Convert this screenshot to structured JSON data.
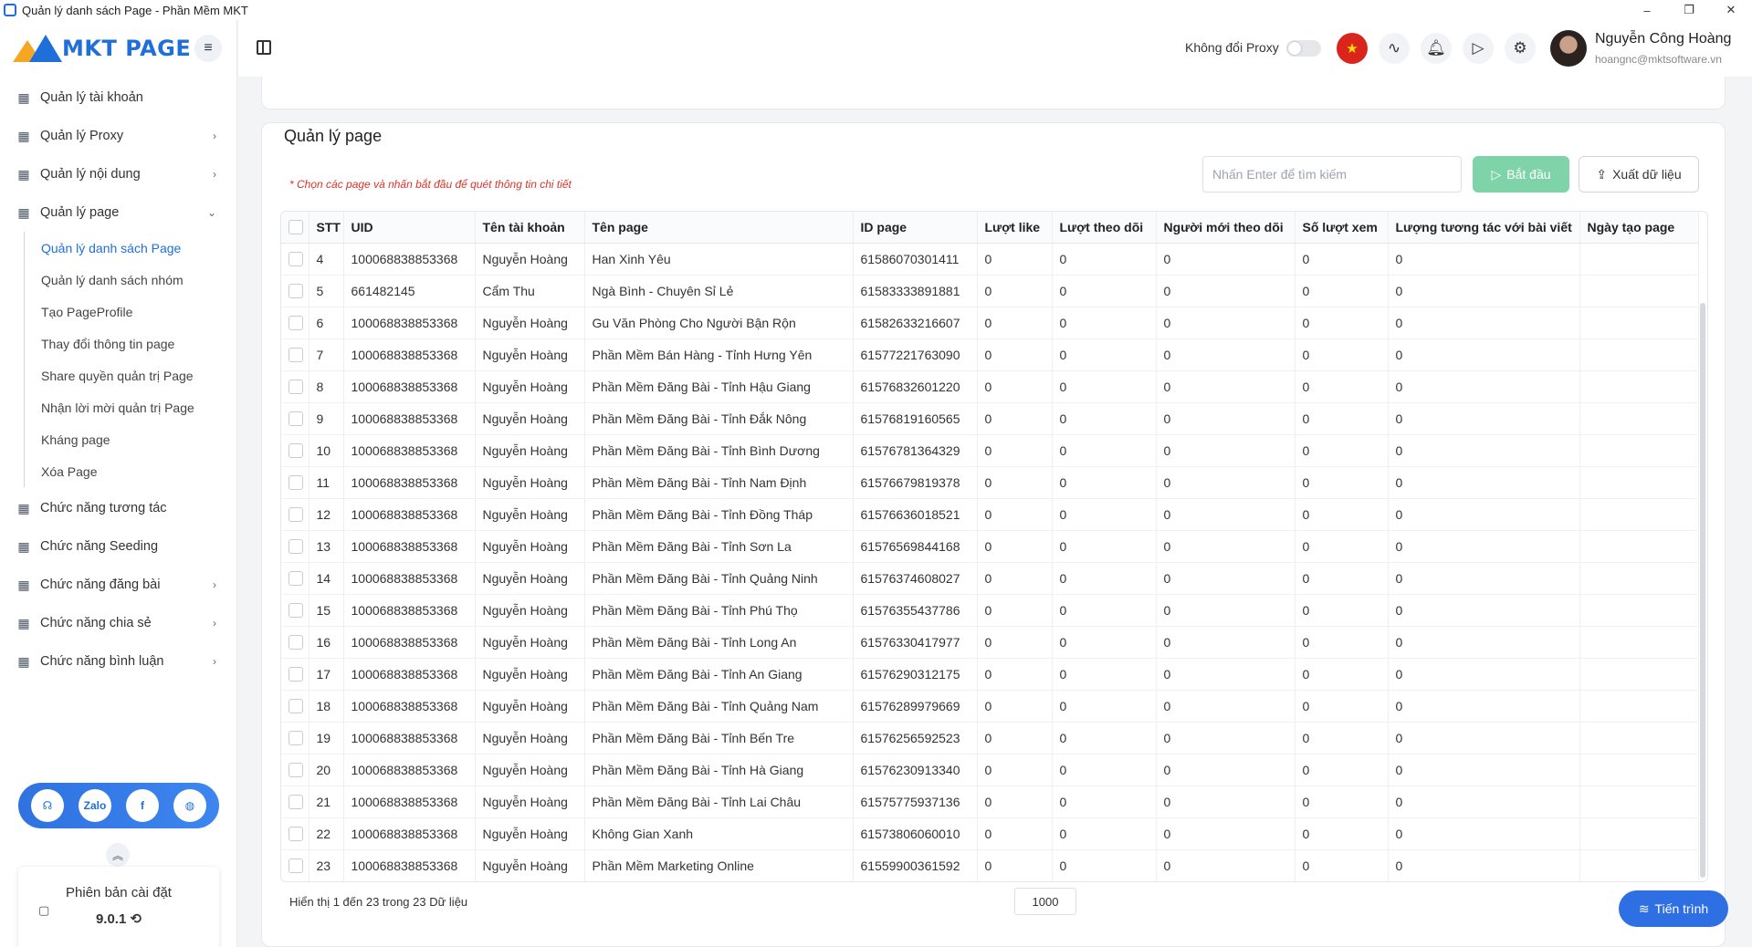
{
  "window": {
    "title": "Quản lý danh sách Page - Phần Mềm MKT",
    "minimize": "–",
    "restore": "❐",
    "close": "✕"
  },
  "logo": {
    "text": "MKT PAGE"
  },
  "sidebar": {
    "items": [
      {
        "label": "Quản lý tài khoản",
        "icon": "grid-icon"
      },
      {
        "label": "Quản lý Proxy",
        "icon": "layers-icon",
        "chevron": "›"
      },
      {
        "label": "Quản lý nội dung",
        "icon": "content-icon",
        "chevron": "›"
      },
      {
        "label": "Quản lý page",
        "icon": "page-icon",
        "chevron": "⌄"
      }
    ],
    "subitems": [
      {
        "label": "Quản lý danh sách Page",
        "active": true
      },
      {
        "label": "Quản lý danh sách nhóm"
      },
      {
        "label": "Tạo PageProfile"
      },
      {
        "label": "Thay đổi thông tin page"
      },
      {
        "label": "Share quyền quản trị Page"
      },
      {
        "label": "Nhận lời mời quản trị Page"
      },
      {
        "label": "Kháng page"
      },
      {
        "label": "Xóa Page"
      }
    ],
    "items2": [
      {
        "label": "Chức năng tương tác",
        "icon": "sparkle-icon"
      },
      {
        "label": "Chức năng Seeding",
        "icon": "seeding-icon"
      },
      {
        "label": "Chức năng đăng bài",
        "icon": "post-icon",
        "chevron": "›"
      },
      {
        "label": "Chức năng chia sẻ",
        "icon": "share-icon",
        "chevron": "›"
      },
      {
        "label": "Chức năng bình luận",
        "icon": "comment-icon",
        "chevron": "›"
      }
    ],
    "social": {
      "zalo": "Zalo",
      "facebook": "f",
      "web": "◍",
      "support": "☊"
    },
    "version": {
      "label": "Phiên bản cài đặt",
      "number": "9.0.1 ⟲"
    }
  },
  "header": {
    "proxy_label": "Không đổi Proxy",
    "user_name": "Nguyễn Công Hoàng",
    "user_email": "hoangnc@mktsoftware.vn"
  },
  "main": {
    "title": "Quản lý page",
    "hint": "* Chọn các page và nhấn bắt đầu để quét thông tin chi tiết",
    "search_placeholder": "Nhấn Enter để tìm kiếm",
    "start_label": "Bắt đầu",
    "export_label": "Xuất dữ liệu",
    "footer_info": "Hiển thị 1 đến 23 trong 23 Dữ liệu",
    "page_size": "1000",
    "progress_label": "Tiến trình"
  },
  "table": {
    "columns": [
      "STT",
      "UID",
      "Tên tài khoản",
      "Tên page",
      "ID page",
      "Lượt like",
      "Lượt theo dõi",
      "Người mới theo dõi",
      "Số lượt xem",
      "Lượng tương tác với bài viết",
      "Ngày tạo page"
    ],
    "rows": [
      [
        "4",
        "100068838853368",
        "Nguyễn Hoàng",
        "Han Xinh Yêu",
        "61586070301411",
        "0",
        "0",
        "0",
        "0",
        "0",
        ""
      ],
      [
        "5",
        "661482145",
        "Cẩm Thu",
        "Ngà Bình - Chuyên Sỉ Lẻ",
        "61583333891881",
        "0",
        "0",
        "0",
        "0",
        "0",
        ""
      ],
      [
        "6",
        "100068838853368",
        "Nguyễn Hoàng",
        "Gu Văn Phòng Cho Người Bận Rộn",
        "61582633216607",
        "0",
        "0",
        "0",
        "0",
        "0",
        ""
      ],
      [
        "7",
        "100068838853368",
        "Nguyễn Hoàng",
        "Phần Mềm Bán Hàng - Tỉnh Hưng Yên",
        "61577221763090",
        "0",
        "0",
        "0",
        "0",
        "0",
        ""
      ],
      [
        "8",
        "100068838853368",
        "Nguyễn Hoàng",
        "Phần Mềm Đăng Bài - Tỉnh Hậu Giang",
        "61576832601220",
        "0",
        "0",
        "0",
        "0",
        "0",
        ""
      ],
      [
        "9",
        "100068838853368",
        "Nguyễn Hoàng",
        "Phần Mềm Đăng Bài - Tỉnh Đắk Nông",
        "61576819160565",
        "0",
        "0",
        "0",
        "0",
        "0",
        ""
      ],
      [
        "10",
        "100068838853368",
        "Nguyễn Hoàng",
        "Phần Mềm Đăng Bài - Tỉnh Bình Dương",
        "61576781364329",
        "0",
        "0",
        "0",
        "0",
        "0",
        ""
      ],
      [
        "11",
        "100068838853368",
        "Nguyễn Hoàng",
        "Phần Mềm Đăng Bài - Tỉnh Nam Định",
        "61576679819378",
        "0",
        "0",
        "0",
        "0",
        "0",
        ""
      ],
      [
        "12",
        "100068838853368",
        "Nguyễn Hoàng",
        "Phần Mềm Đăng Bài - Tỉnh Đồng Tháp",
        "61576636018521",
        "0",
        "0",
        "0",
        "0",
        "0",
        ""
      ],
      [
        "13",
        "100068838853368",
        "Nguyễn Hoàng",
        "Phần Mềm Đăng Bài - Tỉnh Sơn La",
        "61576569844168",
        "0",
        "0",
        "0",
        "0",
        "0",
        ""
      ],
      [
        "14",
        "100068838853368",
        "Nguyễn Hoàng",
        "Phần Mềm Đăng Bài - Tỉnh Quảng Ninh",
        "61576374608027",
        "0",
        "0",
        "0",
        "0",
        "0",
        ""
      ],
      [
        "15",
        "100068838853368",
        "Nguyễn Hoàng",
        "Phần Mềm Đăng Bài - Tỉnh Phú Thọ",
        "61576355437786",
        "0",
        "0",
        "0",
        "0",
        "0",
        ""
      ],
      [
        "16",
        "100068838853368",
        "Nguyễn Hoàng",
        "Phần Mềm Đăng Bài - Tỉnh Long An",
        "61576330417977",
        "0",
        "0",
        "0",
        "0",
        "0",
        ""
      ],
      [
        "17",
        "100068838853368",
        "Nguyễn Hoàng",
        "Phần Mềm Đăng Bài - Tỉnh An Giang",
        "61576290312175",
        "0",
        "0",
        "0",
        "0",
        "0",
        ""
      ],
      [
        "18",
        "100068838853368",
        "Nguyễn Hoàng",
        "Phần Mềm Đăng Bài - Tỉnh Quảng Nam",
        "61576289979669",
        "0",
        "0",
        "0",
        "0",
        "0",
        ""
      ],
      [
        "19",
        "100068838853368",
        "Nguyễn Hoàng",
        "Phần Mềm Đăng Bài - Tỉnh Bến Tre",
        "61576256592523",
        "0",
        "0",
        "0",
        "0",
        "0",
        ""
      ],
      [
        "20",
        "100068838853368",
        "Nguyễn Hoàng",
        "Phần Mềm Đăng Bài - Tỉnh Hà Giang",
        "61576230913340",
        "0",
        "0",
        "0",
        "0",
        "0",
        ""
      ],
      [
        "21",
        "100068838853368",
        "Nguyễn Hoàng",
        "Phần Mềm Đăng Bài - Tỉnh Lai Châu",
        "61575775937136",
        "0",
        "0",
        "0",
        "0",
        "0",
        ""
      ],
      [
        "22",
        "100068838853368",
        "Nguyễn Hoàng",
        "Không Gian Xanh",
        "61573806060010",
        "0",
        "0",
        "0",
        "0",
        "0",
        ""
      ],
      [
        "23",
        "100068838853368",
        "Nguyễn Hoàng",
        "Phần Mềm Marketing Online",
        "61559900361592",
        "0",
        "0",
        "0",
        "0",
        "0",
        ""
      ]
    ]
  }
}
